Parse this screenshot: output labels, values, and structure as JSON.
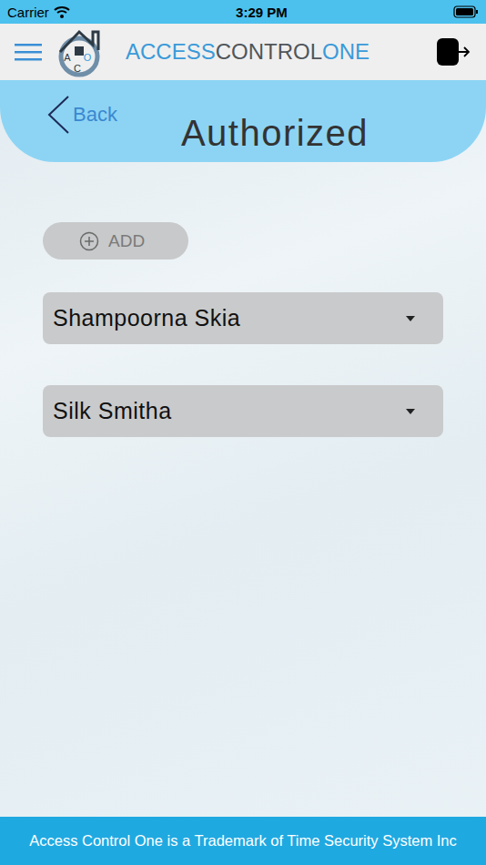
{
  "status_bar": {
    "carrier": "Carrier",
    "time": "3:29 PM"
  },
  "header": {
    "logo_letters": [
      "A",
      "O",
      "C"
    ],
    "brand": [
      {
        "text": "ACCESS",
        "color": "#3a9ad9"
      },
      {
        "text": "CONTROL",
        "color": "#50565b"
      },
      {
        "text": "ONE",
        "color": "#3a9ad9"
      }
    ]
  },
  "page": {
    "back": "Back",
    "title": "Authorized"
  },
  "add_button": {
    "label": "ADD"
  },
  "people": [
    {
      "name": "Shampoorna Skia",
      "expanded": false
    },
    {
      "name": "Silk Smitha",
      "expanded": false
    }
  ],
  "footer": "Access Control One is a Trademark of Time Security System Inc"
}
